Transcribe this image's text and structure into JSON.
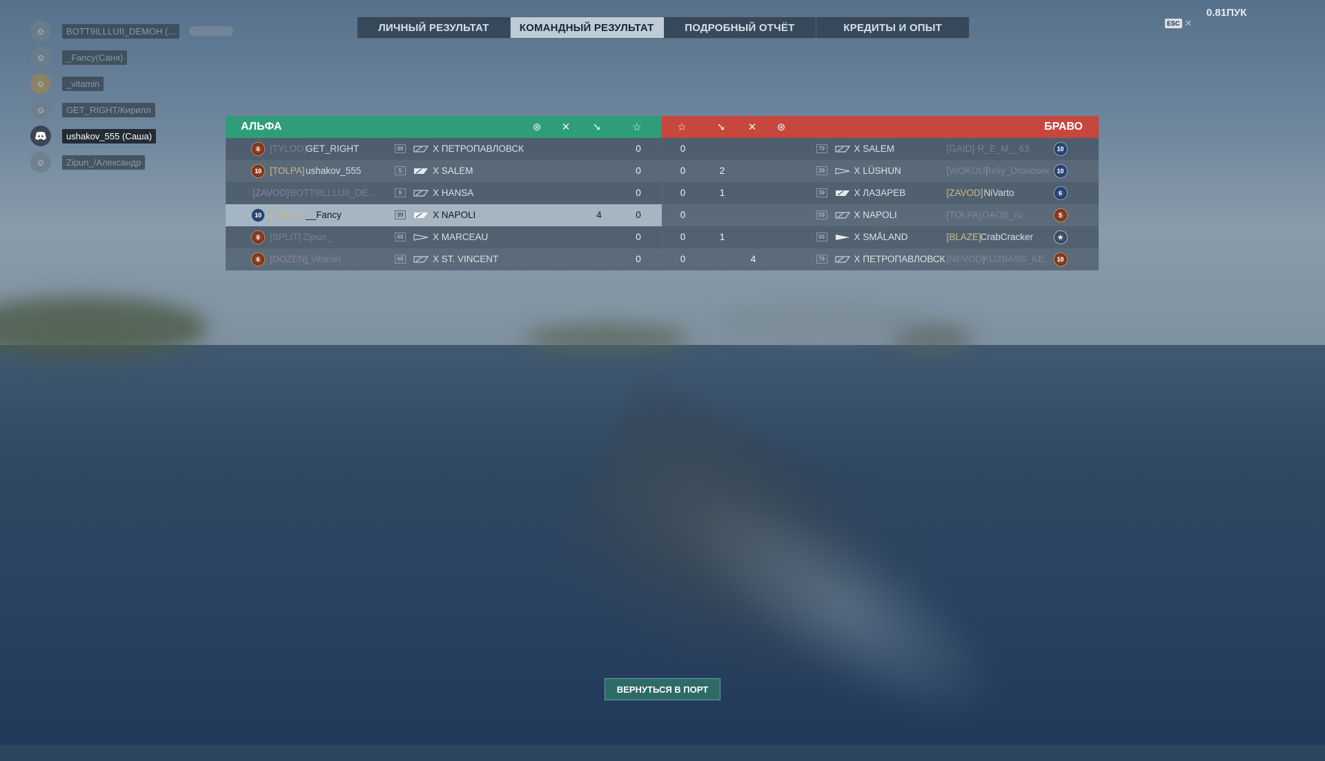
{
  "tabs": [
    {
      "label": "ЛИЧНЫЙ РЕЗУЛЬТАТ",
      "active": false
    },
    {
      "label": "КОМАНДНЫЙ РЕЗУЛЬТАТ",
      "active": true
    },
    {
      "label": "ПОДРОБНЫЙ ОТЧЁТ",
      "active": false
    },
    {
      "label": "КРЕДИТЫ И ОПЫТ",
      "active": false
    }
  ],
  "ping": "0.81ПУК",
  "esc_label": "ESC",
  "voice": [
    {
      "name": "BOTT9ILLLUII_DEMOH (..."
    },
    {
      "name": "_Fancy(Саня)"
    },
    {
      "name": "_vitamin"
    },
    {
      "name": "GET_RIGHT/Кирилл"
    },
    {
      "name": "ushakov_555 (Саша)",
      "active": true,
      "icon": "discord-icon"
    },
    {
      "name": "Zipun_/Александр"
    }
  ],
  "alpha": {
    "title": "АЛЬФА",
    "header_icons": [
      "damage-icon",
      "kills-icon",
      "planes-icon",
      "star-icon"
    ],
    "rows": [
      {
        "rank": "6",
        "clan": "[TYLOO]",
        "player": "GET_RIGHT",
        "level": "99",
        "ship": "X  ПЕТРОПАВЛОВСК",
        "planes": "",
        "score": "0"
      },
      {
        "rank": "10",
        "clan": "[TOLPA]",
        "player": "ushakov_555",
        "level": "5",
        "ship": "X  SALEM",
        "planes": "",
        "score": "0"
      },
      {
        "rank": "",
        "clan": "[ZAVOD]",
        "player": "BOTT9ILLLUII_DE...",
        "level": "9",
        "ship": "X  HANSA",
        "planes": "",
        "score": "0"
      },
      {
        "rank": "10",
        "clan": "[TOLPA]",
        "player": "__Fancy",
        "level": "99",
        "ship": "X  NAPOLI",
        "planes": "4",
        "score": "0",
        "highlight": true
      },
      {
        "rank": "6",
        "clan": "[SPLIT]",
        "player": "Zipun_",
        "level": "69",
        "ship": "X  MARCEAU",
        "planes": "",
        "score": "0"
      },
      {
        "rank": "6",
        "clan": "[DOZEN]",
        "player": "_vitamin",
        "level": "69",
        "ship": "X  ST. VINCENT",
        "planes": "",
        "score": "0"
      }
    ]
  },
  "bravo": {
    "title": "БРАВО",
    "header_icons": [
      "star-icon",
      "planes-icon",
      "kills-icon",
      "damage-icon"
    ],
    "rows": [
      {
        "score": "0",
        "planes": "",
        "kills": "",
        "level": "79",
        "ship": "X  SALEM",
        "clan": "[GAID]",
        "player": "R_E_M__63",
        "rank": "10"
      },
      {
        "score": "0",
        "planes": "2",
        "kills": "",
        "level": "39",
        "ship": "X  LÜSHUN",
        "clan": "[WOKOU]",
        "player": "Beliy_Drovosek",
        "rank": "10"
      },
      {
        "score": "0",
        "planes": "1",
        "kills": "",
        "level": "39",
        "ship": "X  ЛАЗАРЕВ",
        "clan": "[ZAVOD]",
        "player": "NiVarto",
        "rank": "6"
      },
      {
        "score": "0",
        "planes": "",
        "kills": "",
        "level": "59",
        "ship": "X  NAPOLI",
        "clan": "[TOLPA]",
        "player": "DAOS_ru",
        "rank": "5"
      },
      {
        "score": "0",
        "planes": "1",
        "kills": "",
        "level": "99",
        "ship": "X  SMÅLAND",
        "clan": "[BLAZE]",
        "player": "CrabCracker",
        "rank": "★"
      },
      {
        "score": "0",
        "planes": "",
        "kills": "4",
        "level": "79",
        "ship": "X  ПЕТРОПАВЛОВСК",
        "clan": "[NEVOD]",
        "player": "KUZBASS_KE...",
        "rank": "10"
      }
    ]
  },
  "return_button": "ВЕРНУТЬСЯ В ПОРТ"
}
